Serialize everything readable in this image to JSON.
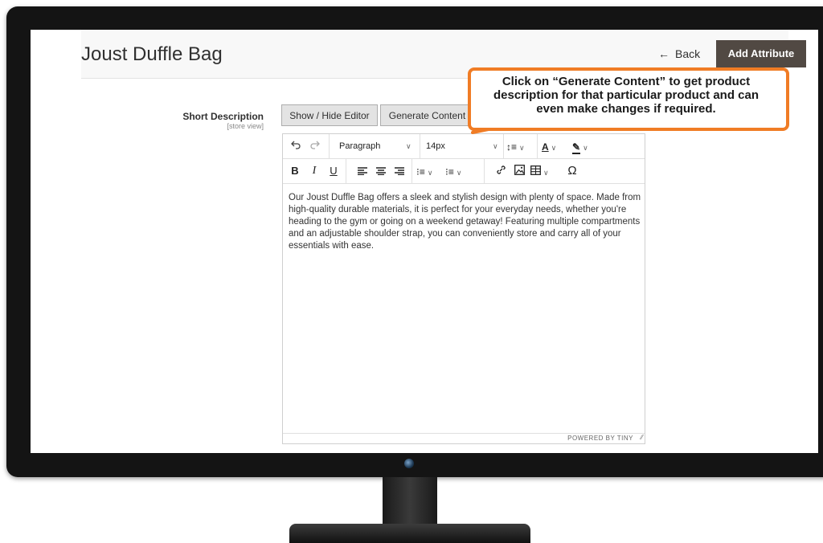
{
  "page": {
    "title": "Joust Duffle Bag",
    "back_label": "Back",
    "add_attribute_label": "Add Attribute"
  },
  "field": {
    "label": "Short Description",
    "scope": "[store view]"
  },
  "buttons": {
    "show_hide_editor": "Show / Hide Editor",
    "generate_content": "Generate Content"
  },
  "toolbar": {
    "block_format": "Paragraph",
    "font_size": "14px"
  },
  "editor": {
    "content": "Our Joust Duffle Bag offers a sleek and stylish design with plenty of space. Made from high-quality durable materials, it is perfect for your everyday needs, whether you're heading to the gym or going on a weekend getaway! Featuring multiple compartments and an adjustable shoulder strap, you can conveniently store and carry all of your essentials with ease.",
    "powered_by": "POWERED BY TINY"
  },
  "callout": {
    "text": "Click on “Generate Content” to get product description for that particular product and can even make changes if required."
  },
  "colors": {
    "callout_border": "#f07c25",
    "primary_button": "#514943",
    "monitor": "#141414"
  }
}
